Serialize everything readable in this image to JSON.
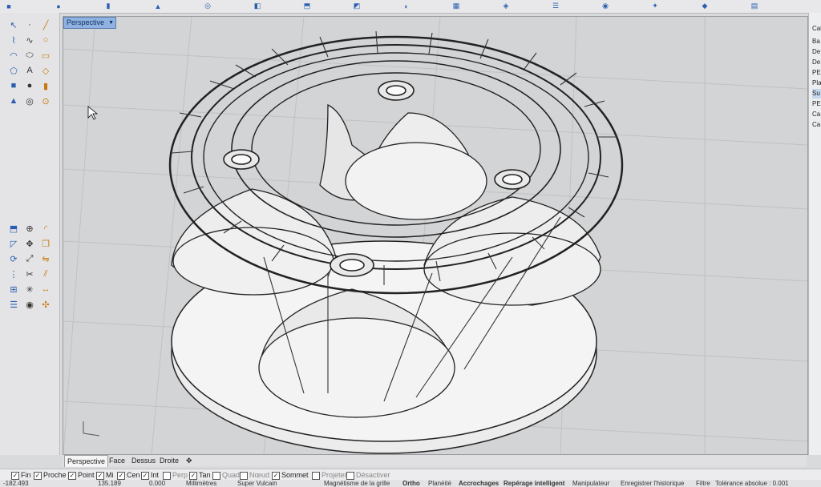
{
  "viewport": {
    "title": "Perspective",
    "menu_arrow": "▼"
  },
  "view_tabs": [
    "Perspective",
    "Face",
    "Dessus",
    "Droite"
  ],
  "view_tab_add": "✥",
  "osnaps": [
    {
      "label": "Fin",
      "checked": true
    },
    {
      "label": "Proche",
      "checked": true
    },
    {
      "label": "Point",
      "checked": true
    },
    {
      "label": "Mi",
      "checked": true
    },
    {
      "label": "Cen",
      "checked": true
    },
    {
      "label": "Int",
      "checked": true
    },
    {
      "label": "Perp",
      "checked": false
    },
    {
      "label": "Tan",
      "checked": true
    },
    {
      "label": "Quad",
      "checked": false
    },
    {
      "label": "Nœud",
      "checked": false
    },
    {
      "label": "Sommet",
      "checked": true
    },
    {
      "label": "Projeter",
      "checked": false
    },
    {
      "label": "Désactiver",
      "checked": false
    }
  ],
  "status": {
    "coord1": "-182.493",
    "coord2": "135.189",
    "coord3": "0.000",
    "units": "Millimètres",
    "layer": "Super Vulcain",
    "grid_snap": "Magnétisme de la grille",
    "ortho": "Ortho",
    "planar": "Planéité",
    "osnap": "Accrochages",
    "smarttrack": "Repérage intelligent",
    "gumball": "Manipulateur",
    "history": "Enregistrer l'historique",
    "filter": "Filtre",
    "tolerance": "Tolérance absolue : 0.001"
  },
  "right_panel": {
    "header": "Cal",
    "items": [
      "Ba",
      "De",
      "De",
      "PE",
      "Pla",
      "Su",
      "PE",
      "Ca",
      "Ca"
    ],
    "selected_index": 5
  },
  "icons": {
    "top": [
      "cube-icon",
      "sphere-icon",
      "cylinder-icon",
      "cone-icon",
      "torus-icon",
      "box-icon",
      "extrude-icon",
      "boolean-icon",
      "fillet-icon",
      "mesh-icon",
      "render-icon",
      "layer-icon",
      "camera-icon",
      "light-icon",
      "material-icon",
      "grid-icon"
    ],
    "left": [
      "select-arrow-icon",
      "point-icon",
      "line-icon",
      "polyline-icon",
      "curve-icon",
      "circle-icon",
      "arc-icon",
      "ellipse-icon",
      "rectangle-icon",
      "polygon-icon",
      "text-icon",
      "surface-icon",
      "solid-box-icon",
      "sphere-icon",
      "cylinder-icon",
      "cone-icon",
      "torus-icon",
      "pipe-icon",
      "extrude-icon",
      "boolean-union-icon",
      "fillet-icon",
      "chamfer-icon",
      "move-icon",
      "copy-icon",
      "rotate-icon",
      "scale-icon",
      "mirror-icon",
      "array-icon",
      "trim-icon",
      "split-icon",
      "join-icon",
      "explode-icon",
      "dimension-icon",
      "layer-icon",
      "render-icon",
      "gumball-icon"
    ]
  },
  "colors": {
    "accent": "#8fb2e0",
    "selected": "#c6d7ef",
    "viewport_bg": "#d3d4d6"
  }
}
